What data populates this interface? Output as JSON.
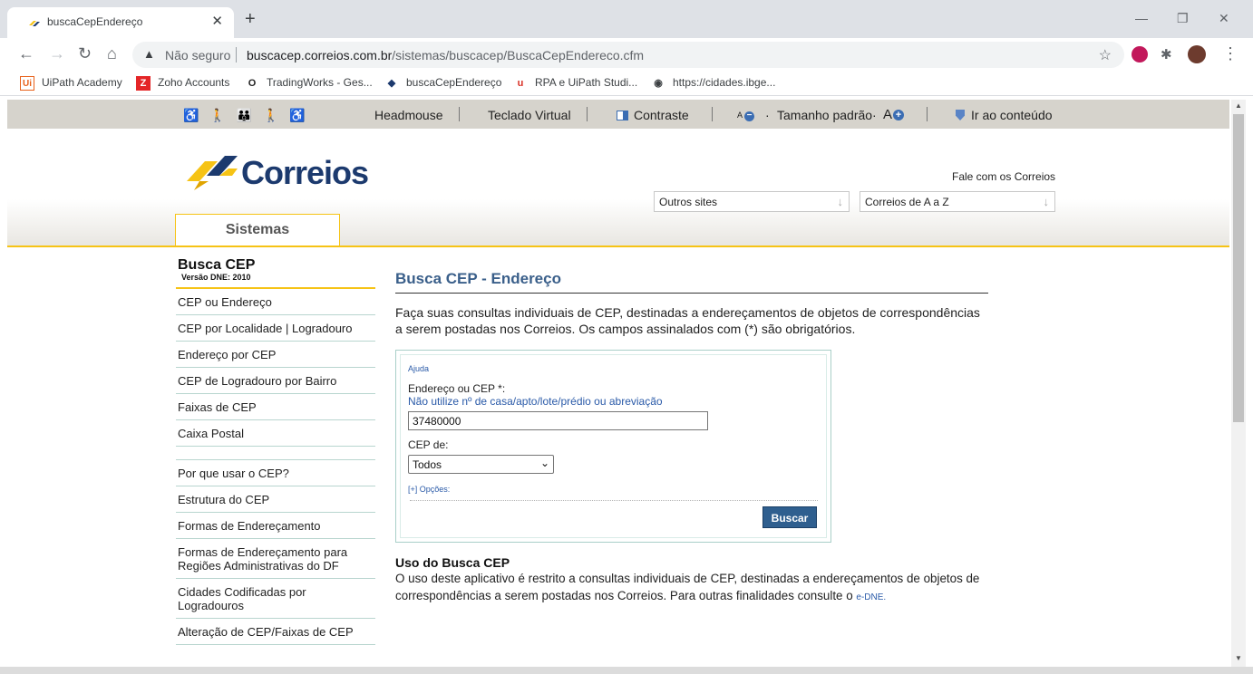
{
  "browser": {
    "tab_title": "buscaCepEndereço",
    "tab_close": "✕",
    "new_tab": "+",
    "window_controls": {
      "minimize": "—",
      "restore": "❐",
      "close": "✕"
    },
    "nav": {
      "back": "←",
      "forward": "→",
      "reload": "↻",
      "home": "⌂"
    },
    "security_label": "Não seguro",
    "url_host": "buscacep.correios.com.br",
    "url_path": "/sistemas/buscacep/BuscaCepEndereco.cfm",
    "star": "☆",
    "menu": "⋮",
    "extension_puzzle": "✱"
  },
  "bookmarks": [
    {
      "label": "UiPath Academy",
      "icon": "Ui",
      "color": "#e8611a"
    },
    {
      "label": "Zoho Accounts",
      "icon": "Z",
      "color": "#e42527"
    },
    {
      "label": "TradingWorks - Ges...",
      "icon": "O",
      "color": "#222222"
    },
    {
      "label": "buscaCepEndereço",
      "icon": "◆",
      "color": "#1c3a6e"
    },
    {
      "label": "RPA e UiPath Studi...",
      "icon": "u",
      "color": "#d93025"
    },
    {
      "label": "https://cidades.ibge...",
      "icon": "◉",
      "color": "#3c4043"
    }
  ],
  "accessibility": {
    "icons": "♿ 🚶 👪 🚶 ♿",
    "headmouse": "Headmouse",
    "teclado": "Teclado Virtual",
    "contraste": "Contraste",
    "font_small": "A",
    "font_minus": "−",
    "dot1": "·",
    "tamanho": "Tamanho padrão",
    "dot2": "·",
    "font_big": "A",
    "font_plus": "+",
    "ir_conteudo": "Ir ao conteúdo"
  },
  "header": {
    "logo_text": "Correios",
    "fale": "Fale com os Correios",
    "outros_sites": "Outros sites",
    "correios_az": "Correios de A a Z",
    "tab_sistemas": "Sistemas"
  },
  "sidebar": {
    "title": "Busca CEP",
    "version": "Versão DNE: 2010",
    "items": [
      "CEP ou Endereço",
      "CEP por Localidade | Logradouro",
      "Endereço por CEP",
      "CEP de Logradouro por Bairro",
      "Faixas de CEP",
      "Caixa Postal",
      "",
      "Por que usar o CEP?",
      "Estrutura do CEP",
      "Formas de Endereçamento",
      "Formas de Endereçamento para Regiões Administrativas do DF",
      "Cidades Codificadas por Logradouros",
      "Alteração de CEP/Faixas de CEP"
    ]
  },
  "main": {
    "title": "Busca CEP - Endereço",
    "intro": "Faça suas consultas individuais de CEP, destinadas a endereçamentos de objetos de correspondências a serem postadas nos Correios. Os campos assinalados com (*) são obrigatórios.",
    "form": {
      "ajuda": "Ajuda",
      "endereco_label": "Endereço ou CEP *:",
      "hint": "Não utilize nº de casa/apto/lote/prédio ou abreviação",
      "endereco_value": "37480000",
      "cep_de_label": "CEP de:",
      "cep_de_value": "Todos",
      "opcoes": "[+] Opções:",
      "buscar": "Buscar"
    },
    "uso_title": "Uso do Busca CEP",
    "uso_text": "O uso deste aplicativo é restrito a consultas individuais de CEP, destinadas a endereçamentos de objetos de correspondências a serem postadas nos Correios. Para outras finalidades consulte o",
    "uso_link": "e-DNE."
  }
}
